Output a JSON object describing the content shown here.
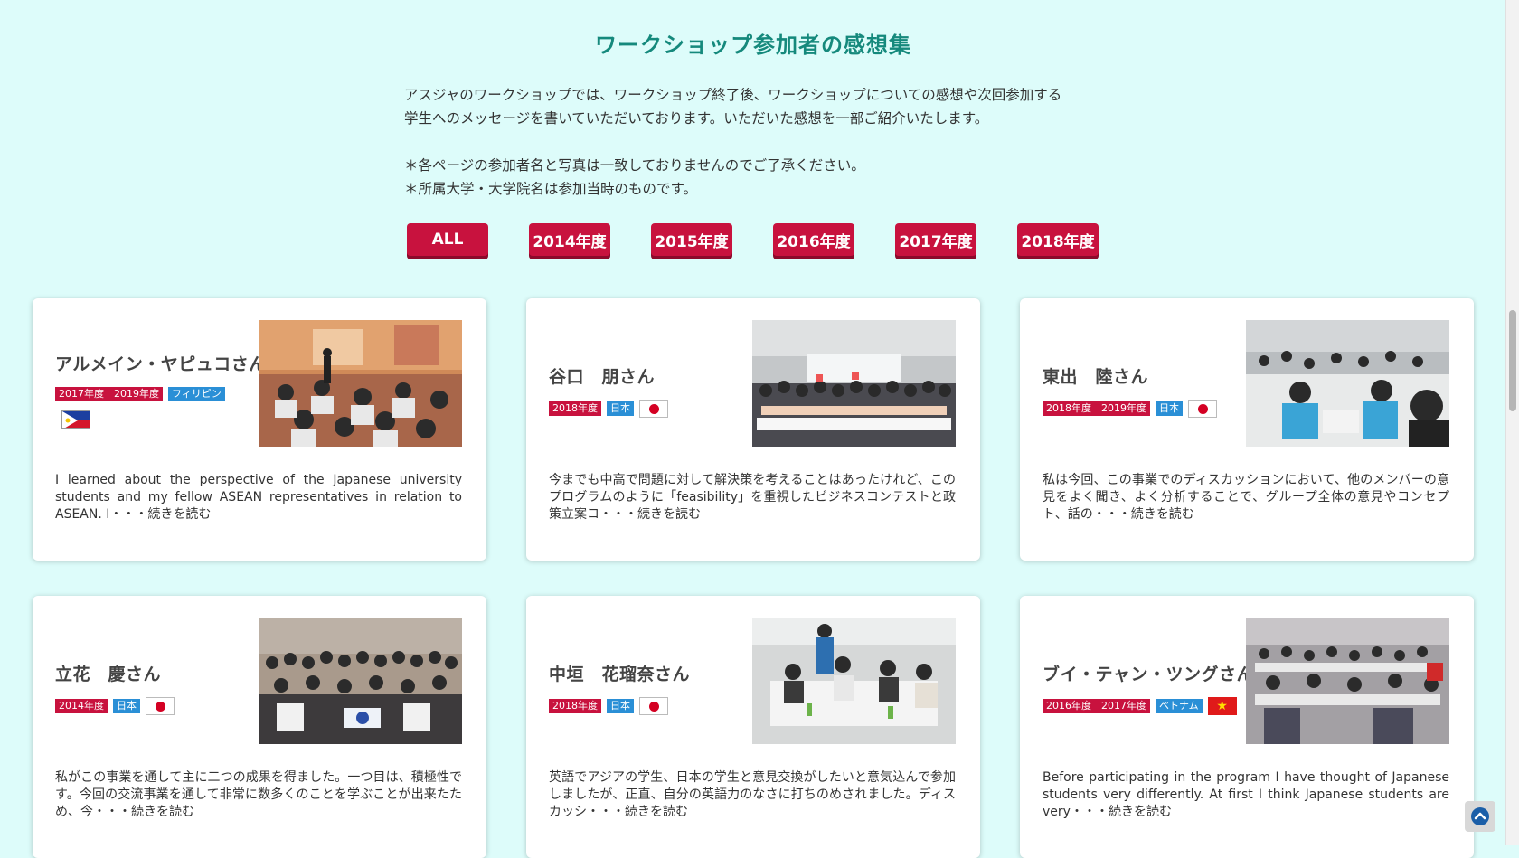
{
  "page": {
    "title": "ワークショップ参加者の感想集",
    "intro_line1": "アスジャのワークショップでは、ワークショップ終了後、ワークショップについての感想や次回参加する",
    "intro_line2": "学生へのメッセージを書いていただいております。いただいた感想を一部ご紹介いたします。",
    "note1": "＊各ページの参加者名と写真は一致しておりませんのでご了承ください。",
    "note2": "＊所属大学・大学院名は参加当時のものです。"
  },
  "filters": [
    "ALL",
    "2014年度",
    "2015年度",
    "2016年度",
    "2017年度",
    "2018年度"
  ],
  "cards": [
    {
      "name": "アルメイン・ヤピュコさん",
      "years": "2017年度　2019年度",
      "country": "フィリピン",
      "flag": "ph",
      "excerpt": "I learned about the perspective of the Japanese university students and my fellow ASEAN representatives in relation to ASEAN. I・・・続きを読む"
    },
    {
      "name": "谷口　朋さん",
      "years": "2018年度",
      "country": "日本",
      "flag": "jp",
      "excerpt": "今までも中高で問題に対して解決策を考えることはあったけれど、このプログラムのように「feasibility」を重視したビジネスコンテストと政策立案コ・・・続きを読む"
    },
    {
      "name": "東出　陸さん",
      "years": "2018年度　2019年度",
      "country": "日本",
      "flag": "jp",
      "excerpt": "私は今回、この事業でのディスカッションにおいて、他のメンバーの意見をよく聞き、よく分析することで、グループ全体の意見やコンセプト、話の・・・続きを読む"
    },
    {
      "name": "立花　慶さん",
      "years": "2014年度",
      "country": "日本",
      "flag": "jp",
      "excerpt": "私がこの事業を通して主に二つの成果を得ました。一つ目は、積極性です。今回の交流事業を通して非常に数多くのことを学ぶことが出来たため、今・・・続きを読む"
    },
    {
      "name": "中垣　花瑠奈さん",
      "years": "2018年度",
      "country": "日本",
      "flag": "jp",
      "excerpt": "英語でアジアの学生、日本の学生と意見交換がしたいと意気込んで参加しましたが、正直、自分の英語力のなさに打ちのめされました。ディスカッシ・・・続きを読む"
    },
    {
      "name": "ブイ・テャン・ツングさん",
      "years": "2016年度　2017年度",
      "country": "ベトナム",
      "flag": "vn",
      "excerpt": "Before participating in the program I have thought of Japanese students very differently. At first I think Japanese students are very・・・続きを読む"
    }
  ],
  "icons": {
    "scroll_top": "chevron-up-circle-icon"
  }
}
